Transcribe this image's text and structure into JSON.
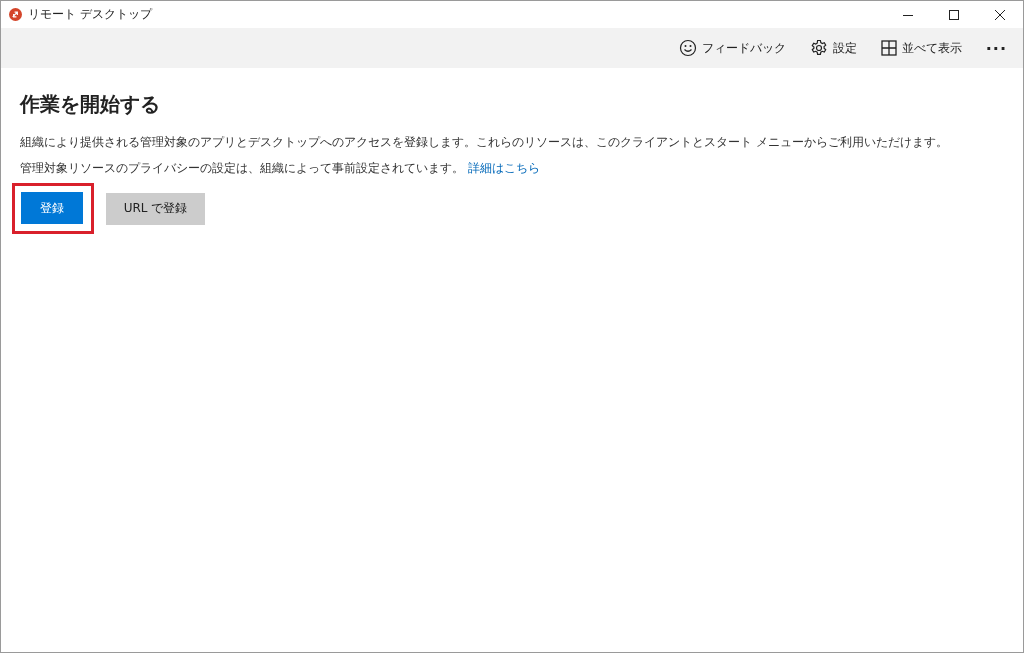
{
  "window": {
    "title": "リモート デスクトップ"
  },
  "toolbar": {
    "items": [
      {
        "kind": "feedback",
        "label": "フィードバック"
      },
      {
        "kind": "settings",
        "label": "設定"
      },
      {
        "kind": "tiles",
        "label": "並べて表示"
      },
      {
        "kind": "more",
        "label": "···"
      }
    ]
  },
  "content": {
    "heading": "作業を開始する",
    "description": "組織により提供される管理対象のアプリとデスクトップへのアクセスを登録します。これらのリソースは、このクライアントとスタート メニューからご利用いただけます。",
    "privacy_note": "管理対象リソースのプライバシーの設定は、組織によって事前設定されています。",
    "link": "詳細はこちら",
    "buttons": [
      {
        "label": "登録",
        "kind": "primary",
        "highlighted": true
      },
      {
        "label": "URL で登録",
        "kind": "secondary",
        "highlighted": false
      }
    ]
  }
}
